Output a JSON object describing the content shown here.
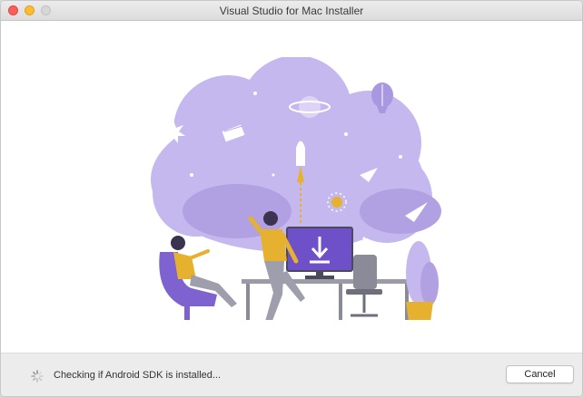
{
  "window": {
    "title": "Visual Studio for Mac Installer"
  },
  "footer": {
    "status_text": "Checking if Android SDK is installed...",
    "cancel_label": "Cancel"
  },
  "illustration": {
    "download_icon": "download-arrow-icon"
  },
  "colors": {
    "accent_purple": "#6e50c8",
    "cloud_purple": "#b7a6e8",
    "mustard": "#e6b12e"
  }
}
